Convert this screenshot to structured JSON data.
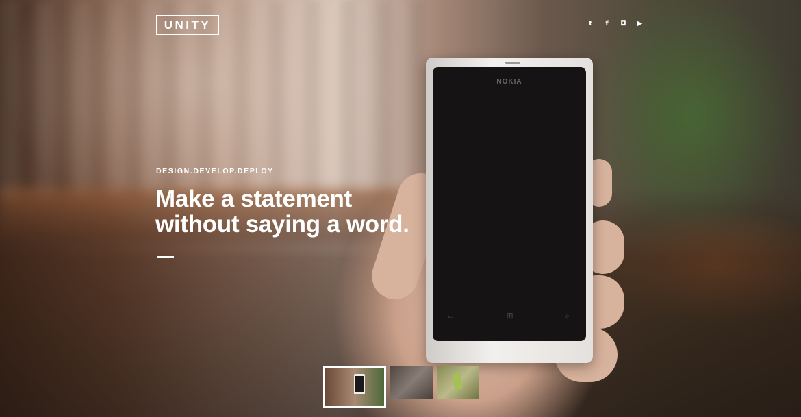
{
  "header": {
    "logo_text": "UNITY",
    "social": [
      {
        "name": "twitter-icon",
        "glyph": "t"
      },
      {
        "name": "facebook-icon",
        "glyph": "f"
      },
      {
        "name": "instagram-icon",
        "glyph": "◘"
      },
      {
        "name": "youtube-icon",
        "glyph": "▶"
      }
    ]
  },
  "hero": {
    "kicker": "DESIGN.DEVELOP.DEPLOY",
    "headline_line1": "Make a statement",
    "headline_line2": "without saying a word.",
    "phone_brand": "NOKIA",
    "phone_keys": [
      "←",
      "⊞",
      "⌕"
    ]
  },
  "thumbnails": {
    "active_index": 0,
    "items": [
      {
        "name": "slide-thumbnail-1"
      },
      {
        "name": "slide-thumbnail-2"
      },
      {
        "name": "slide-thumbnail-3"
      }
    ]
  },
  "colors": {
    "text": "#ffffff",
    "background_dark": "#3a2a20"
  }
}
